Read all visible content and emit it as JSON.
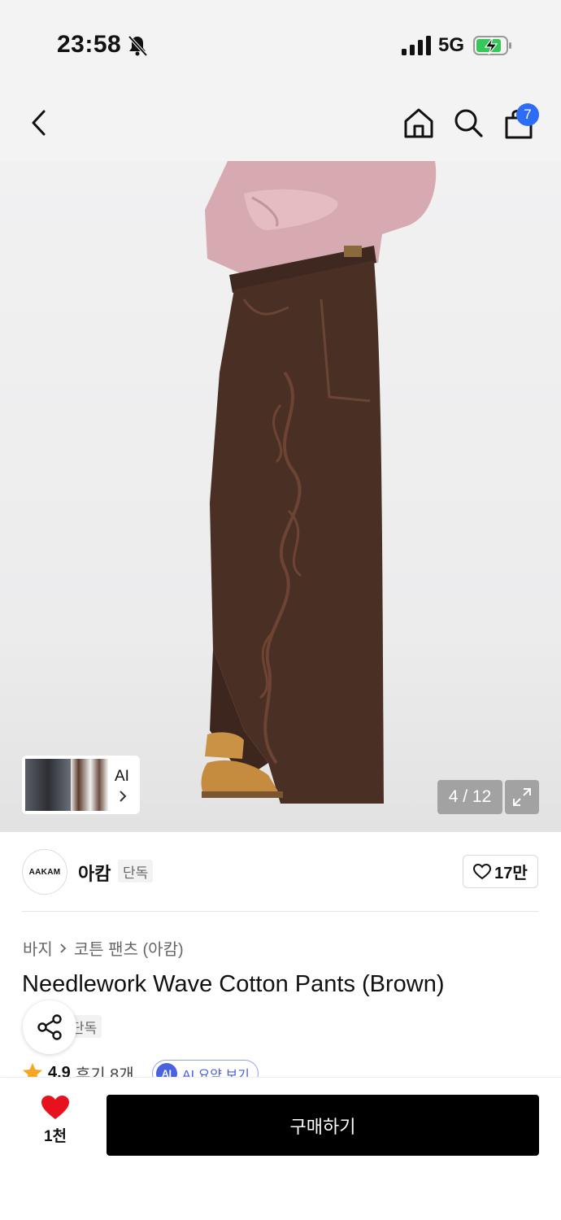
{
  "status_bar": {
    "time": "23:58",
    "network": "5G"
  },
  "header": {
    "cart_count": "7"
  },
  "gallery": {
    "ai_label": "AI",
    "counter": "4 / 12"
  },
  "brand": {
    "logo_text": "AAKAM",
    "name": "아캄",
    "tag": "단독",
    "like_count": "17만"
  },
  "breadcrumb": {
    "category": "바지",
    "subcategory": "코튼 팬츠 (아캄)"
  },
  "product": {
    "title": "Needlework Wave Cotton Pants (Brown)",
    "tag": "단독"
  },
  "rating": {
    "score": "4.9",
    "reviews": "후기 8개",
    "ai_summary_badge": "AI",
    "ai_summary": "AI 요약 보기"
  },
  "bottom": {
    "favorite_count": "1천",
    "buy_label": "구매하기"
  },
  "colors": {
    "accent_blue": "#2d6df6",
    "heart_red": "#e8121f",
    "pants_brown": "#4a2f24",
    "shirt_pink": "#d9aab3",
    "boot_tan": "#c99245"
  }
}
